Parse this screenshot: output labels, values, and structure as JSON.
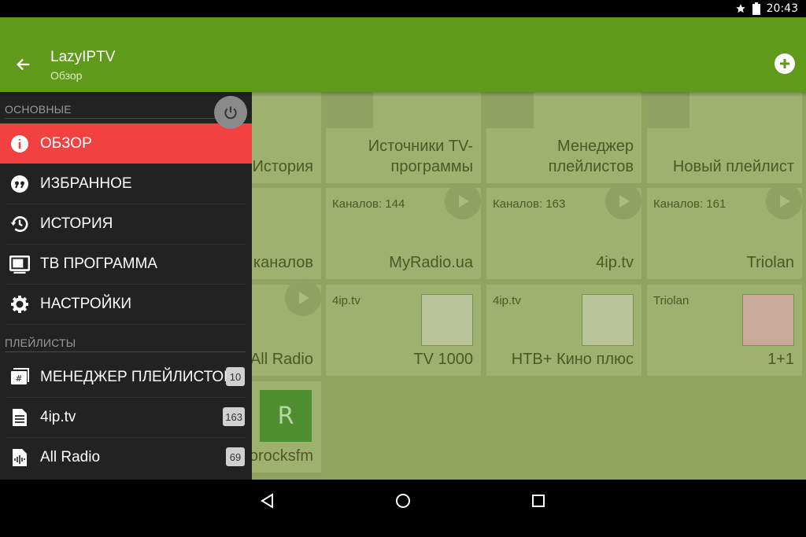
{
  "status": {
    "time": "20:43"
  },
  "appbar": {
    "title": "LazyIPTV",
    "subtitle": "Обзор"
  },
  "grid": {
    "tiles": [
      {
        "name": "История",
        "sub": ""
      },
      {
        "name": "Источники TV-программы",
        "sub": ""
      },
      {
        "name": "Менеджер плейлистов",
        "sub": ""
      },
      {
        "name": "Новый плейлист",
        "sub": ""
      },
      {
        "name": "каналов",
        "sub": ""
      },
      {
        "name": "MyRadio.ua",
        "sub": "Каналов: 144"
      },
      {
        "name": "4ip.tv",
        "sub": "Каналов: 163"
      },
      {
        "name": "Triolan",
        "sub": "Каналов: 161"
      },
      {
        "name": "All Radio",
        "sub": ""
      },
      {
        "name": "TV 1000",
        "sub": "4ip.tv"
      },
      {
        "name": "НТВ+ Кино плюс",
        "sub": "4ip.tv"
      },
      {
        "name": "1+1",
        "sub": "Triolan"
      },
      {
        "name": "orocksfm",
        "sub": ""
      }
    ],
    "r_letter": "R"
  },
  "drawer": {
    "section_main": "ОСНОВНЫЕ",
    "section_playlists": "ПЛЕЙЛИСТЫ",
    "items": [
      {
        "label": "ОБЗОР",
        "icon": "info-icon"
      },
      {
        "label": "ИЗБРАННОЕ",
        "icon": "quote-icon"
      },
      {
        "label": "ИСТОРИЯ",
        "icon": "history-icon"
      },
      {
        "label": "ТВ ПРОГРАММА",
        "icon": "tv-icon"
      },
      {
        "label": "НАСТРОЙКИ",
        "icon": "gear-icon"
      }
    ],
    "playlists": [
      {
        "label": "МЕНЕДЖЕР ПЛЕЙЛИСТОВ",
        "badge": "10",
        "icon": "playlist-manager-icon"
      },
      {
        "label": "4ip.tv",
        "badge": "163",
        "icon": "document-icon"
      },
      {
        "label": "All Radio",
        "badge": "69",
        "icon": "audio-file-icon"
      }
    ]
  },
  "colors": {
    "appbar": "#5f9a1a",
    "active": "#f24141",
    "drawer": "#222222"
  }
}
